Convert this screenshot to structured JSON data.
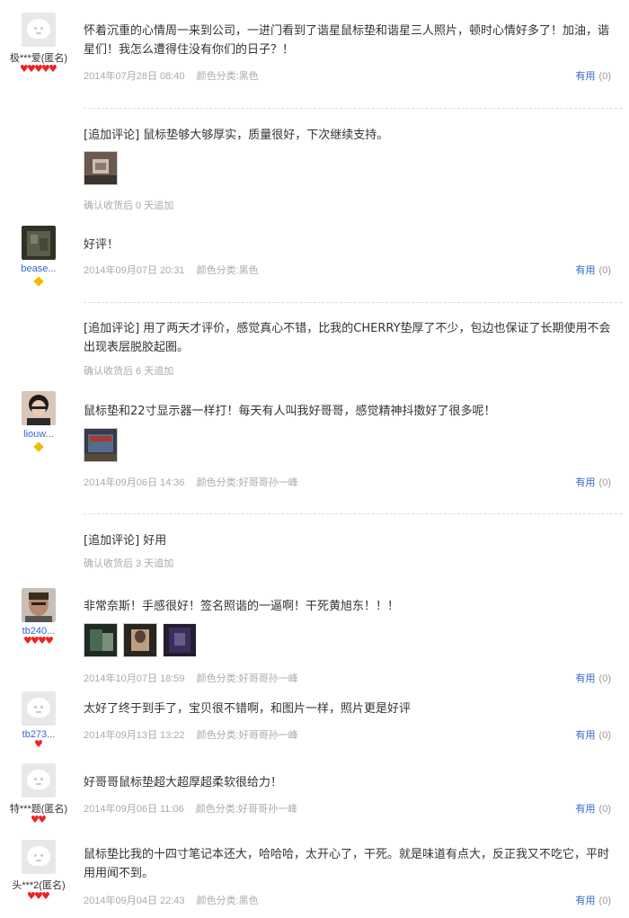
{
  "reviews": [
    {
      "username": "极***爱(匿名)",
      "text": "怀着沉重的心情周一来到公司，一进门看到了谐星鼠标垫和谐星三人照片，顿时心情好多了！加油，谐星们！我怎么遭得住没有你们的日子？！",
      "date": "2014年07月28日 08:40",
      "color": "颜色分类:黑色",
      "useful_label": "有用",
      "useful_count": "(0)",
      "followup": "[追加评论] 鼠标垫够大够厚实，质量很好，下次继续支持。",
      "followup_note": "确认收货后 0 天追加"
    },
    {
      "username": "bease...",
      "text": "好评！",
      "date": "2014年09月07日 20:31",
      "color": "颜色分类:黑色",
      "useful_label": "有用",
      "useful_count": "(0)",
      "followup": "[追加评论] 用了两天才评价，感觉真心不错，比我的CHERRY垫厚了不少，包边也保证了长期使用不会出现表层脱胶起圈。",
      "followup_note": "确认收货后 6 天追加"
    },
    {
      "username": "liouw...",
      "text": "鼠标垫和22寸显示器一样打！每天有人叫我好哥哥，感觉精神抖擞好了很多呢！",
      "date": "2014年09月06日 14:36",
      "color": "颜色分类:好哥哥孙一峰",
      "useful_label": "有用",
      "useful_count": "(0)",
      "followup": "[追加评论] 好用",
      "followup_note": "确认收货后 3 天追加"
    },
    {
      "username": "tb240...",
      "text": "非常奈斯！手感很好！签名照谐的一逼啊！干死黄旭东！！！",
      "date": "2014年10月07日 18:59",
      "color": "颜色分类:好哥哥孙一峰",
      "useful_label": "有用",
      "useful_count": "(0)"
    },
    {
      "username": "tb273...",
      "text": "太好了终于到手了，宝贝很不错啊，和图片一样，照片更是好评",
      "date": "2014年09月13日 13:22",
      "color": "颜色分类:好哥哥孙一峰",
      "useful_label": "有用",
      "useful_count": "(0)"
    },
    {
      "username": "特***题(匿名)",
      "text": "好哥哥鼠标垫超大超厚超柔软很给力！",
      "date": "2014年09月06日 11:06",
      "color": "颜色分类:好哥哥孙一峰",
      "useful_label": "有用",
      "useful_count": "(0)"
    },
    {
      "username": "头***2(匿名)",
      "text": "鼠标垫比我的十四寸笔记本还大，哈哈哈，太开心了，干死。就是味道有点大，反正我又不吃它，平时用用闻不到。",
      "date": "2014年09月04日 22:43",
      "color": "颜色分类:黑色",
      "useful_label": "有用",
      "useful_count": "(0)"
    }
  ],
  "colors": {
    "link": "#3366cc",
    "muted": "#aaaaaa",
    "heart": "#ee2222",
    "diamond": "#f5b800"
  }
}
